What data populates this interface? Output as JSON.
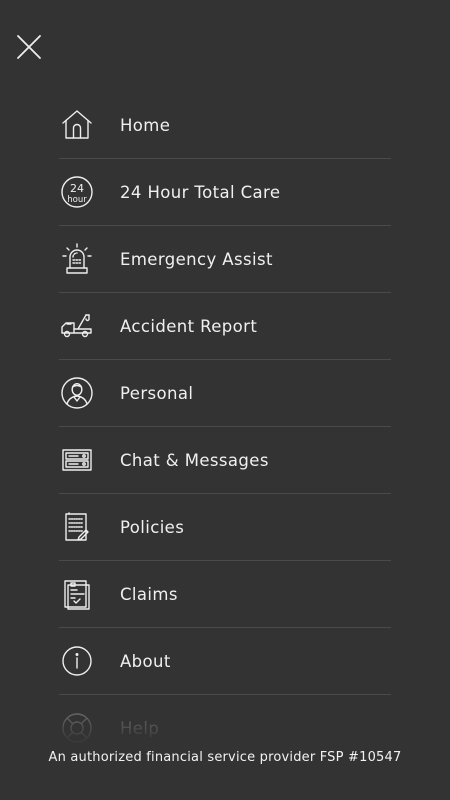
{
  "colors": {
    "background": "#333333",
    "text": "#f0f0f0",
    "divider": "#4a4a4a"
  },
  "header": {
    "close_icon": "close-icon"
  },
  "menu": {
    "items": [
      {
        "label": "Home",
        "icon": "home-icon"
      },
      {
        "label": "24 Hour Total Care",
        "icon": "24-hour-icon"
      },
      {
        "label": "Emergency Assist",
        "icon": "siren-icon"
      },
      {
        "label": "Accident Report",
        "icon": "tow-truck-icon"
      },
      {
        "label": "Personal",
        "icon": "person-icon"
      },
      {
        "label": "Chat & Messages",
        "icon": "chat-messages-icon"
      },
      {
        "label": "Policies",
        "icon": "policies-icon"
      },
      {
        "label": "Claims",
        "icon": "claims-icon"
      },
      {
        "label": "About",
        "icon": "info-icon"
      },
      {
        "label": "Help",
        "icon": "lifebuoy-icon"
      }
    ]
  },
  "footer": {
    "text": "An authorized financial service provider FSP #10547"
  }
}
